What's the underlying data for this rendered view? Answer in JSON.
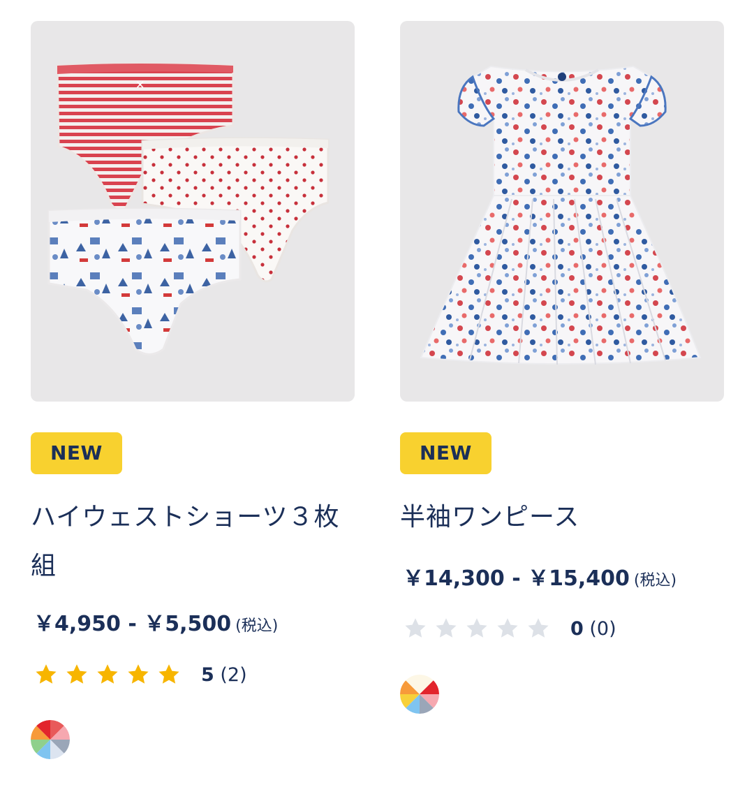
{
  "products": [
    {
      "badge": "NEW",
      "title": "ハイウェストショーツ３枚組",
      "price": "￥4,950 - ￥5,500",
      "tax_note": "(税込)",
      "rating_score": "5",
      "rating_count": "(2)",
      "stars_filled": 5,
      "image_icon": "striped-underwear-set-image",
      "swatch_colors": [
        "#e85a5a",
        "#f6a8b0",
        "#9aa6b8",
        "#dce4f0",
        "#7fc4f0",
        "#8fd08c",
        "#f79a3a",
        "#e2242c"
      ]
    },
    {
      "badge": "NEW",
      "title": "半袖ワンピース",
      "price": "￥14,300 - ￥15,400",
      "tax_note": "(税込)",
      "rating_score": "0",
      "rating_count": "(0)",
      "stars_filled": 0,
      "image_icon": "floral-dress-image",
      "swatch_colors": [
        "#fdf7e6",
        "#e2242c",
        "#f6a8b0",
        "#9aa6b8",
        "#7fc4f0",
        "#f7d03a",
        "#f79a3a",
        "#fdf7e6"
      ]
    }
  ],
  "colors": {
    "text": "#1b2f58",
    "badge": "#f8d12f",
    "star_filled": "#f7b500",
    "star_empty": "#dde1e7",
    "image_bg": "#e8e7e8"
  }
}
